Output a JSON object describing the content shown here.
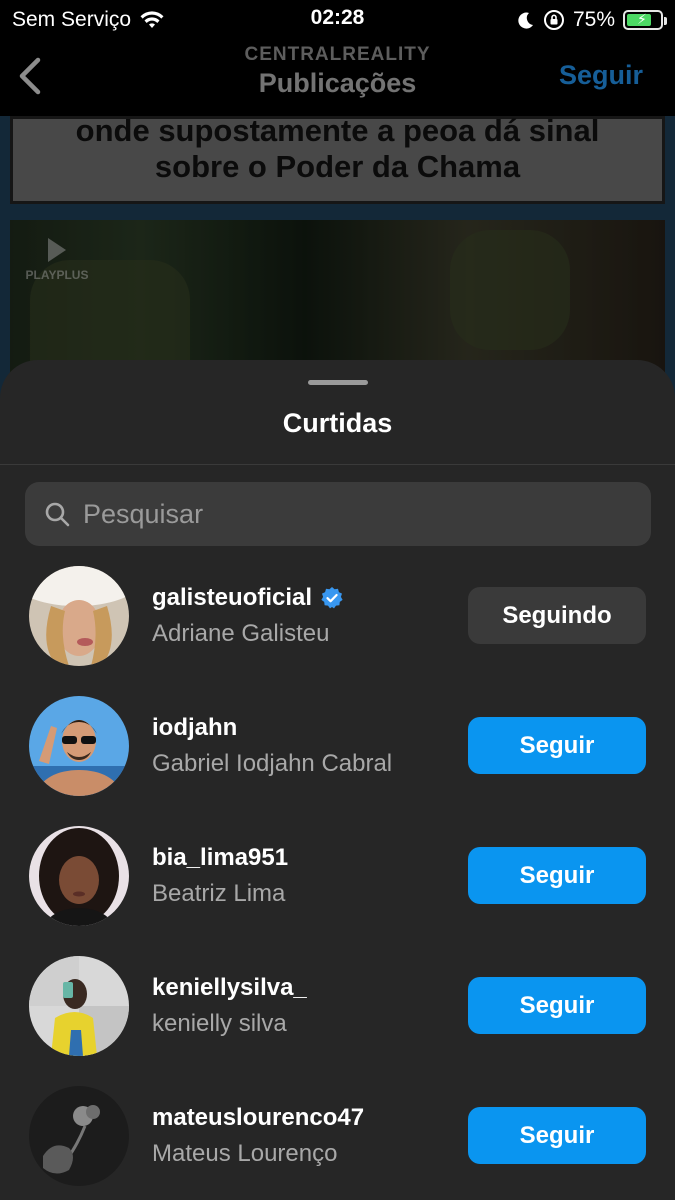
{
  "status_bar": {
    "carrier": "Sem Serviço",
    "time": "02:28",
    "battery_percent": "75%",
    "battery_level": 0.75,
    "icons": [
      "wifi-icon",
      "moon-icon",
      "orientation-lock-icon",
      "battery-charging-icon"
    ]
  },
  "nav": {
    "account": "CENTRALREALITY",
    "title": "Publicações",
    "follow_label": "Seguir",
    "back_icon": "chevron-left-icon"
  },
  "post": {
    "caption_line1": "onde supostamente a peoa dá sinal",
    "caption_line2": "sobre o Poder da Chama",
    "watermark": "PLAYPLUS"
  },
  "sheet": {
    "title": "Curtidas",
    "search_placeholder": "Pesquisar",
    "accent_color": "#0a95f0",
    "users": [
      {
        "username": "galisteuoficial",
        "full_name": "Adriane Galisteu",
        "verified": true,
        "button": "Seguindo",
        "following": true
      },
      {
        "username": "iodjahn",
        "full_name": "Gabriel Iodjahn Cabral",
        "verified": false,
        "button": "Seguir",
        "following": false
      },
      {
        "username": "bia_lima951",
        "full_name": "Beatriz Lima",
        "verified": false,
        "button": "Seguir",
        "following": false
      },
      {
        "username": "keniellysilva_",
        "full_name": "kenielly silva",
        "verified": false,
        "button": "Seguir",
        "following": false
      },
      {
        "username": "mateuslourenco47",
        "full_name": "Mateus Lourenço",
        "verified": false,
        "button": "Seguir",
        "following": false
      }
    ]
  }
}
